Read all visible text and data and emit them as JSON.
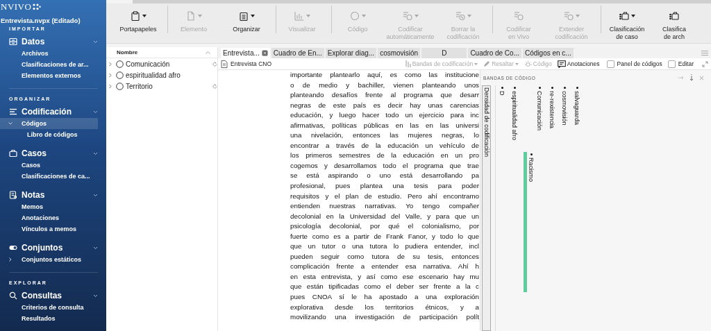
{
  "sidebar": {
    "logo": "NVIVO",
    "file": "Entrevista.nvpx (Editado)",
    "sections": [
      {
        "heading": "IMPORTAR",
        "groups": [
          {
            "title": "Datos",
            "kind": "data",
            "expanded": true,
            "items": [
              {
                "label": "Archivos",
                "selected": false
              },
              {
                "label": "Clasificaciones de ar...",
                "selected": false
              },
              {
                "label": "Elementos externos",
                "selected": false
              }
            ]
          }
        ]
      },
      {
        "heading": "ORGANIZAR",
        "groups": [
          {
            "title": "Codificación",
            "kind": "coding",
            "expanded": true,
            "items": [
              {
                "label": "Códigos",
                "selected": true,
                "expanded": true,
                "children": [
                  {
                    "label": "Libro de códigos",
                    "selected": false
                  }
                ]
              }
            ]
          },
          {
            "title": "Casos",
            "kind": "cases",
            "expanded": true,
            "items": [
              {
                "label": "Casos",
                "selected": false
              },
              {
                "label": "Clasificaciones de ca...",
                "selected": false
              }
            ]
          },
          {
            "title": "Notas",
            "kind": "notes",
            "expanded": true,
            "items": [
              {
                "label": "Memos",
                "selected": false
              },
              {
                "label": "Anotaciones",
                "selected": false
              },
              {
                "label": "Vínculos a memos",
                "selected": false
              }
            ]
          },
          {
            "title": "Conjuntos",
            "kind": "sets",
            "expanded": true,
            "items": [
              {
                "label": "Conjuntos estáticos",
                "selected": false,
                "expanded": false
              }
            ]
          }
        ]
      },
      {
        "heading": "EXPLORAR",
        "groups": [
          {
            "title": "Consultas",
            "kind": "queries",
            "expanded": true,
            "items": [
              {
                "label": "Criterios de consulta",
                "selected": false
              },
              {
                "label": "Resultados",
                "selected": false
              }
            ]
          }
        ]
      }
    ]
  },
  "ribbon": {
    "buttons": [
      {
        "lines": [
          "Portapapeles"
        ],
        "kind": "clipboard",
        "disabled": false,
        "dropdown": true,
        "group_start": false
      },
      {
        "lines": [
          "Elemento"
        ],
        "kind": "document",
        "disabled": true,
        "dropdown": true,
        "group_start": true
      },
      {
        "lines": [
          "Organizar"
        ],
        "kind": "list",
        "disabled": false,
        "dropdown": true,
        "group_start": false
      },
      {
        "lines": [
          "Visualizar"
        ],
        "kind": "chart",
        "disabled": true,
        "dropdown": true,
        "group_start": true
      },
      {
        "lines": [
          "Código"
        ],
        "kind": "circle",
        "disabled": true,
        "dropdown": true,
        "group_start": true
      },
      {
        "lines": [
          "Codificar",
          "automáticamente"
        ],
        "kind": "autocode",
        "disabled": true,
        "dropdown": true,
        "group_start": false
      },
      {
        "lines": [
          "Borrar la",
          "codificación"
        ],
        "kind": "uncode",
        "disabled": true,
        "dropdown": true,
        "group_start": false
      },
      {
        "lines": [
          "Codificar",
          "en Vivo"
        ],
        "kind": "livecode",
        "disabled": true,
        "dropdown": false,
        "group_start": true
      },
      {
        "lines": [
          "Extender",
          "codificación"
        ],
        "kind": "extend",
        "disabled": true,
        "dropdown": true,
        "group_start": false
      },
      {
        "lines": [
          "Clasificación",
          "de caso"
        ],
        "kind": "case",
        "disabled": false,
        "dropdown": true,
        "group_start": true
      },
      {
        "lines": [
          "Clasifica",
          "de arch"
        ],
        "kind": "filecls",
        "disabled": false,
        "dropdown": false,
        "group_start": false
      }
    ]
  },
  "codes_panel": {
    "column": "Nombre",
    "rows": [
      {
        "name": "Comunicación",
        "expanded": false,
        "linked": true
      },
      {
        "name": "espiritualidad afro",
        "expanded": false,
        "linked": false
      },
      {
        "name": "Territorio",
        "expanded": false,
        "linked": true
      }
    ]
  },
  "document": {
    "tabs": [
      {
        "label": "Entrevista...",
        "selected": true
      },
      {
        "label": "Cuadro de En...",
        "selected": false
      },
      {
        "label": "Explorar diag...",
        "selected": false
      },
      {
        "label": "cosmovisión",
        "selected": false
      },
      {
        "label": "D",
        "selected": false
      },
      {
        "label": "Cuadro de Co...",
        "selected": false
      },
      {
        "label": "Códigos en c...",
        "selected": false
      }
    ],
    "source": "Entrevista CNO",
    "toolbar": [
      {
        "label": "Bandas de codificación",
        "kind": "bands",
        "disabled": true
      },
      {
        "label": "Resaltar",
        "kind": "highlight",
        "disabled": true
      },
      {
        "label": "Código",
        "kind": "code",
        "disabled": true
      },
      {
        "label": "Anotaciones",
        "kind": "annotations",
        "disabled": false
      },
      {
        "label": "Panel de códigos",
        "kind": "checkbox",
        "checked": false
      },
      {
        "label": "Editar",
        "kind": "checkbox",
        "checked": false
      }
    ],
    "lines": [
      "importante plantearlo aquí, es como las institucione",
      "o de medio y bachiller, vienen planteando unos",
      "planteando desafíos frente al programa que desarr",
      "negras de este país es decir hay unas carencias",
      "educación, y luego hacer todo un ejercicio para inc",
      "afirmativas, políticas públicas en las en las universi",
      "una nivelación, entonces las mujeres negras, lo",
      "encontrar a través de la educación un vehículo de",
      "los primeros semestres de la educación en un pro",
      "cogemos y desarrollamos todo el programa que trae",
      "se está aspirando o uno está desarrollando pa",
      "profesional, pues plantea una tesis para poder",
      "requisitos y el plan de estudio. Pero ahí encontramo",
      "entienden nuestras narrativas. Yo tengo compañer",
      "decolonial en la Universidad del Valle, y para que un",
      "psicología decolonial, por qué el colonialismo, por",
      "fuerte como es a partir de Frank Fanor, y todo lo que",
      "que un tutor o una tutora lo pudiera entender, incl",
      "pueden seguir como tutora de su tesis, entonces",
      "complicación frente a entender esa narrativa. Ahí h",
      "en esta entrevista, y así como ese escenario hay mu",
      "que están tipificadas como el deber ser frente a la c",
      "pues CNOA sí le ha apostado a una exploración",
      "explorativa desde los territorios étnicos, y a",
      "movilizando una investigación de participación polít"
    ],
    "stripes": {
      "title": "BANDAS DE CÓDIGO",
      "density_label": "Densidad de codificación",
      "items": [
        {
          "label": "D",
          "kind": "plain"
        },
        {
          "label": "espiritualidad afro",
          "kind": "plain"
        },
        {
          "label": "Racismo",
          "kind": "coded",
          "color": "#5ecb9c"
        },
        {
          "label": "Comunicación",
          "kind": "plain"
        },
        {
          "label": "re-rexistencia",
          "kind": "plain"
        },
        {
          "label": "cosmovisión",
          "kind": "plain"
        },
        {
          "label": "salvaguarda",
          "kind": "plain"
        }
      ]
    }
  }
}
